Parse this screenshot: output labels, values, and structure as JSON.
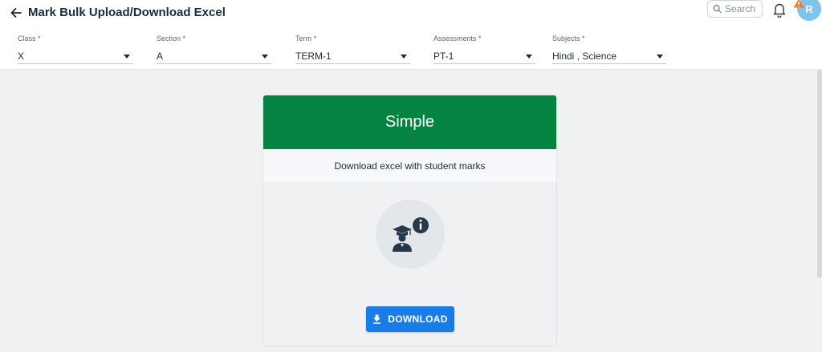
{
  "header": {
    "title": "Mark Bulk Upload/Download Excel",
    "search_placeholder": "Search",
    "avatar_initial": "R"
  },
  "filters": [
    {
      "label": "Class *",
      "value": "X"
    },
    {
      "label": "Section *",
      "value": "A"
    },
    {
      "label": "Term *",
      "value": "TERM-1"
    },
    {
      "label": "Assessments *",
      "value": "PT-1"
    },
    {
      "label": "Subjects *",
      "value": "Hindi , Science"
    }
  ],
  "card": {
    "title": "Simple",
    "subtitle": "Download excel with student marks",
    "button_label": "DOWNLOAD",
    "header_color": "#058441",
    "button_color": "#1a7ce6"
  },
  "icons": {
    "back": "arrow-left-icon",
    "search": "search-icon",
    "bell": "bell-icon",
    "alert": "warning-icon",
    "student_info": "student-info-icon",
    "download": "download-icon"
  }
}
